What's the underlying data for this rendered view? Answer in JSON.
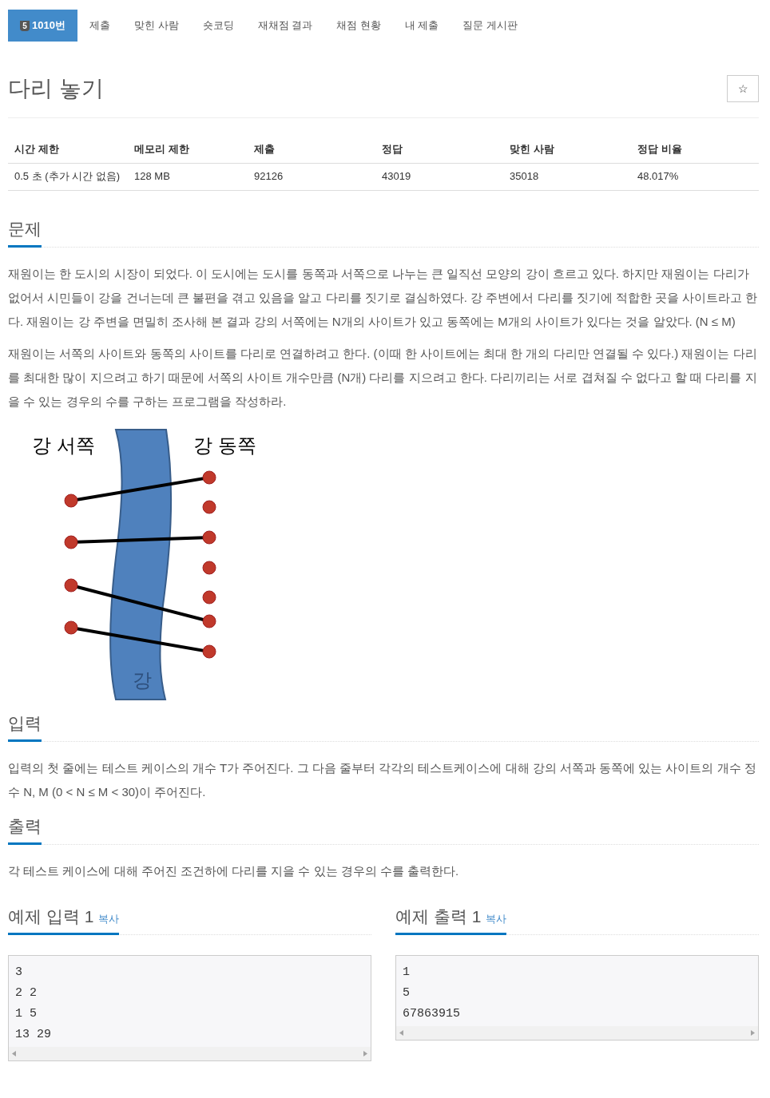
{
  "tabs": [
    {
      "label": "1010번",
      "badge": "5",
      "selected": true
    },
    {
      "label": "제출",
      "selected": false
    },
    {
      "label": "맞힌 사람",
      "selected": false
    },
    {
      "label": "숏코딩",
      "selected": false
    },
    {
      "label": "재채점 결과",
      "selected": false
    },
    {
      "label": "채점 현황",
      "selected": false
    },
    {
      "label": "내 제출",
      "selected": false
    },
    {
      "label": "질문 게시판",
      "selected": false
    }
  ],
  "title": "다리 놓기",
  "star_button": "☆",
  "info_table": {
    "columns": [
      "시간 제한",
      "메모리 제한",
      "제출",
      "정답",
      "맞힌 사람",
      "정답 비율"
    ],
    "rows": [
      [
        "0.5 초 (추가 시간 없음)",
        "128 MB",
        "92126",
        "43019",
        "35018",
        "48.017%"
      ]
    ]
  },
  "sections": [
    {
      "heading": "문제",
      "paragraphs": [
        "재원이는 한 도시의 시장이 되었다. 이 도시에는 도시를 동쪽과 서쪽으로 나누는 큰 일직선 모양의 강이 흐르고 있다. 하지만 재원이는 다리가 없어서 시민들이 강을 건너는데 큰 불편을 겪고 있음을 알고 다리를 짓기로 결심하였다. 강 주변에서 다리를 짓기에 적합한 곳을 사이트라고 한다. 재원이는 강 주변을 면밀히 조사해 본 결과 강의 서쪽에는 N개의 사이트가 있고 동쪽에는 M개의 사이트가 있다는 것을 알았다. (N ≤ M)",
        "재원이는 서쪽의 사이트와 동쪽의 사이트를 다리로 연결하려고 한다. (이때 한 사이트에는 최대 한 개의 다리만 연결될 수 있다.) 재원이는 다리를 최대한 많이 지으려고 하기 때문에 서쪽의 사이트 개수만큼 (N개) 다리를 지으려고 한다. 다리끼리는 서로 겹쳐질 수 없다고 할 때 다리를 지을 수 있는 경우의 수를 구하는 프로그램을 작성하라."
      ],
      "figure": {
        "west_label": "강 서쪽",
        "east_label": "강 동쪽",
        "river_label": "강"
      }
    },
    {
      "heading": "입력",
      "paragraphs": [
        "입력의 첫 줄에는 테스트 케이스의 개수 T가 주어진다. 그 다음 줄부터 각각의 테스트케이스에 대해 강의 서쪽과 동쪽에 있는 사이트의 개수 정수 N, M (0 < N ≤ M < 30)이 주어진다."
      ]
    },
    {
      "heading": "출력",
      "paragraphs": [
        "각 테스트 케이스에 대해 주어진 조건하에 다리를 지을 수 있는 경우의 수를 출력한다."
      ]
    }
  ],
  "samples": [
    {
      "heading": "예제 입력 1",
      "copy": "복사",
      "lines": [
        "3",
        "2 2",
        "1 5",
        "13 29"
      ]
    },
    {
      "heading": "예제 출력 1",
      "copy": "복사",
      "lines": [
        "1",
        "5",
        "67863915"
      ]
    }
  ]
}
